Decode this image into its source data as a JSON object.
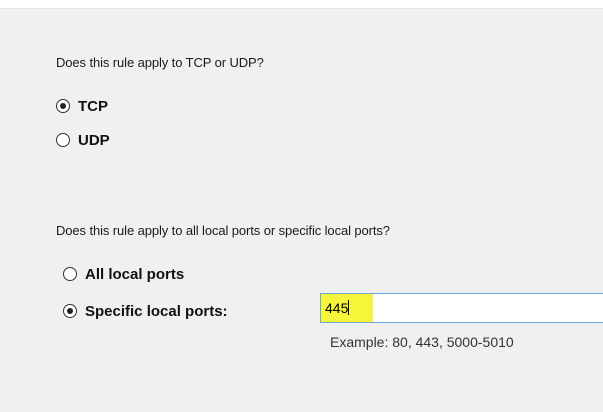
{
  "protocol_section": {
    "question": "Does this rule apply to TCP or UDP?",
    "options": [
      {
        "label": "TCP",
        "checked": true
      },
      {
        "label": "UDP",
        "checked": false
      }
    ]
  },
  "ports_section": {
    "question": "Does this rule apply to all local ports or specific local ports?",
    "options": [
      {
        "label": "All local ports",
        "checked": false
      },
      {
        "label": "Specific local ports:",
        "checked": true
      }
    ],
    "port_input": {
      "value": "445"
    },
    "example": "Example: 80, 443, 5000-5010"
  },
  "colors": {
    "panel_bg": "#f0f0f0",
    "highlight": "#f5f53a",
    "input_border": "#6aa8d8"
  }
}
